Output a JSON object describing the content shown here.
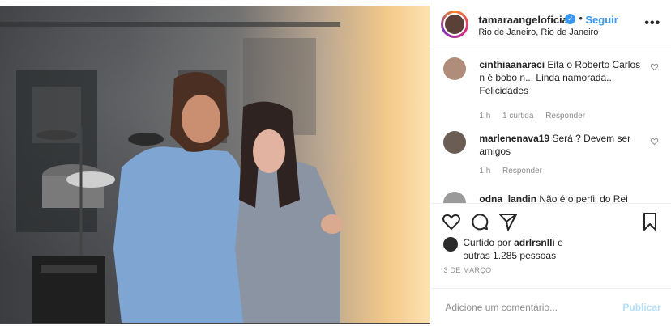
{
  "post": {
    "username": "tamaraangeloficial",
    "follow_label": "Seguir",
    "separator": "•",
    "location": "Rio de Janeiro, Rio de Janeiro",
    "more_label": "•••"
  },
  "comments": [
    {
      "username": "cinthiaanaraci",
      "text": "Eita o Roberto Carlos n é bobo n... Linda namorada... Felicidades",
      "time": "1 h",
      "likes": "1 curtida",
      "reply": "Responder"
    },
    {
      "username": "marlenenava19",
      "text": "Será ? Devem ser amigos",
      "time": "1 h",
      "reply": "Responder"
    },
    {
      "username": "odna_landin",
      "text": "Não é o perfil do Rei"
    }
  ],
  "likes": {
    "prefix": "Curtido por",
    "user": "adrlrsnlli",
    "suffix": "e outras 1.285 pessoas"
  },
  "date": "3 DE MARÇO",
  "composer": {
    "placeholder": "Adicione um comentário...",
    "publish_label": "Publicar"
  },
  "colors": {
    "accent": "#3897f0",
    "publish_disabled": "#b2dffc"
  }
}
